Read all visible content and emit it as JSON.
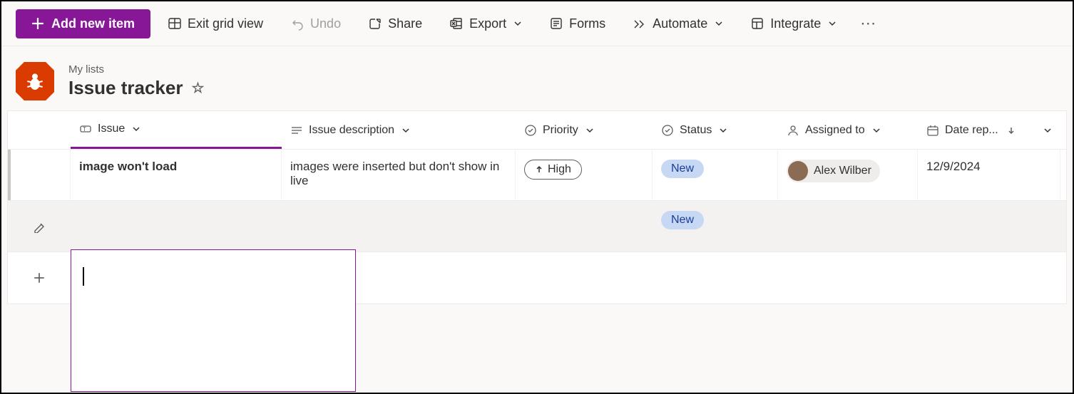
{
  "toolbar": {
    "add_new": "Add new item",
    "exit_grid": "Exit grid view",
    "undo": "Undo",
    "share": "Share",
    "export": "Export",
    "forms": "Forms",
    "automate": "Automate",
    "integrate": "Integrate"
  },
  "header": {
    "breadcrumb": "My lists",
    "title": "Issue tracker"
  },
  "columns": {
    "issue": "Issue",
    "description": "Issue description",
    "priority": "Priority",
    "status": "Status",
    "assigned": "Assigned to",
    "date_reported": "Date rep..."
  },
  "rows": [
    {
      "issue": "image won't load",
      "description": "images were inserted but don't show in live",
      "priority": "High",
      "status": "New",
      "assigned": "Alex Wilber",
      "date_reported": "12/9/2024"
    },
    {
      "issue": "",
      "description": "",
      "priority": "",
      "status": "New",
      "assigned": "",
      "date_reported": ""
    }
  ]
}
